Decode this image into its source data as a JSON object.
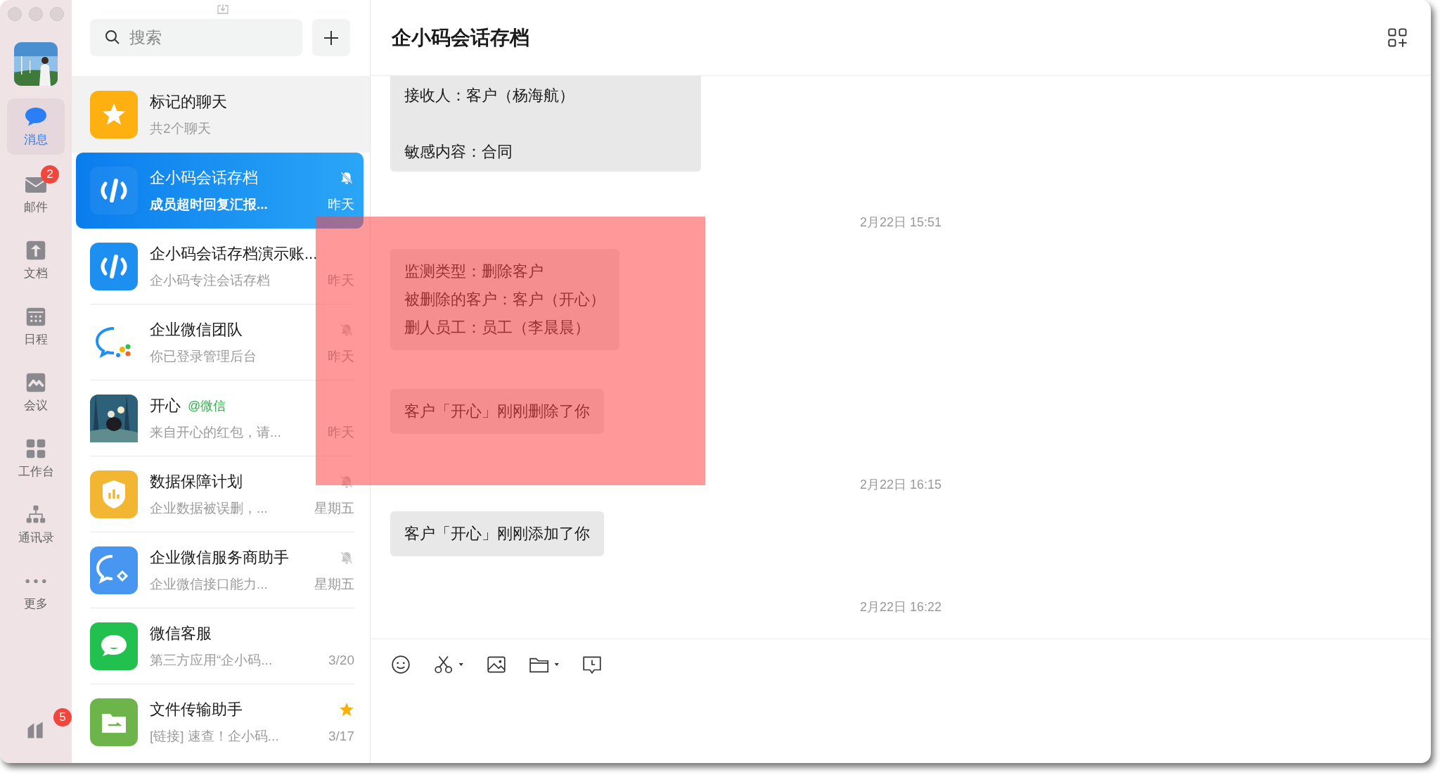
{
  "sidebar": {
    "items": [
      {
        "label": "消息",
        "selected": true
      },
      {
        "label": "邮件",
        "selected": false,
        "badge": "2"
      },
      {
        "label": "文档",
        "selected": false
      },
      {
        "label": "日程",
        "selected": false
      },
      {
        "label": "会议",
        "selected": false
      },
      {
        "label": "工作台",
        "selected": false
      },
      {
        "label": "通讯录",
        "selected": false
      },
      {
        "label": "更多",
        "selected": false
      }
    ],
    "bottom_badge": "5"
  },
  "search": {
    "placeholder": "搜索"
  },
  "chats": [
    {
      "kind": "group",
      "title": "标记的聊天",
      "subtitle": "共2个聊天",
      "selected": false,
      "muted": false,
      "starred": false
    },
    {
      "kind": "chat",
      "title": "企小码会话存档",
      "subtitle": "成员超时回复汇报...",
      "time": "昨天",
      "selected": true,
      "muted": true,
      "starred": false
    },
    {
      "kind": "chat",
      "title": "企小码会话存档演示账...",
      "subtitle": "企小码专注会话存档",
      "time": "昨天",
      "selected": false,
      "muted": false,
      "starred": false
    },
    {
      "kind": "chat",
      "title": "企业微信团队",
      "subtitle": "你已登录管理后台",
      "time": "昨天",
      "selected": false,
      "muted": true,
      "starred": false
    },
    {
      "kind": "chat",
      "title": "开心",
      "tag": "@微信",
      "subtitle": "来自开心的红包，请...",
      "time": "昨天",
      "selected": false,
      "muted": false,
      "starred": false
    },
    {
      "kind": "chat",
      "title": "数据保障计划",
      "subtitle": "企业数据被误删，...",
      "time": "星期五",
      "selected": false,
      "muted": true,
      "starred": false
    },
    {
      "kind": "chat",
      "title": "企业微信服务商助手",
      "subtitle": "企业微信接口能力...",
      "time": "星期五",
      "selected": false,
      "muted": true,
      "starred": false
    },
    {
      "kind": "chat",
      "title": "微信客服",
      "subtitle": "第三方应用“企小码...",
      "time": "3/20",
      "selected": false,
      "muted": false,
      "starred": false
    },
    {
      "kind": "chat",
      "title": "文件传输助手",
      "subtitle": "[链接] 速查！企小码...",
      "time": "3/17",
      "selected": false,
      "muted": false,
      "starred": true
    }
  ],
  "conversation": {
    "title": "企小码会话存档",
    "messages": [
      {
        "kind": "bubble",
        "cut_top": true,
        "spaced": true,
        "lines": [
          "接收人：客户（杨海航）",
          "敏感内容：合同"
        ]
      },
      {
        "kind": "time",
        "text": "2月22日 15:51"
      },
      {
        "kind": "bubble",
        "cut_top": false,
        "spaced": false,
        "lines": [
          "监测类型：删除客户",
          "被删除的客户：客户（开心）",
          "删人员工：员工（李晨晨）"
        ]
      },
      {
        "kind": "bubble",
        "cut_top": false,
        "lines": [
          "客户「开心」刚刚删除了你"
        ]
      },
      {
        "kind": "time",
        "text": "2月22日 16:15"
      },
      {
        "kind": "bubble",
        "cut_top": false,
        "lines": [
          "客户「开心」刚刚添加了你"
        ]
      },
      {
        "kind": "time",
        "text": "2月22日 16:22"
      }
    ]
  }
}
